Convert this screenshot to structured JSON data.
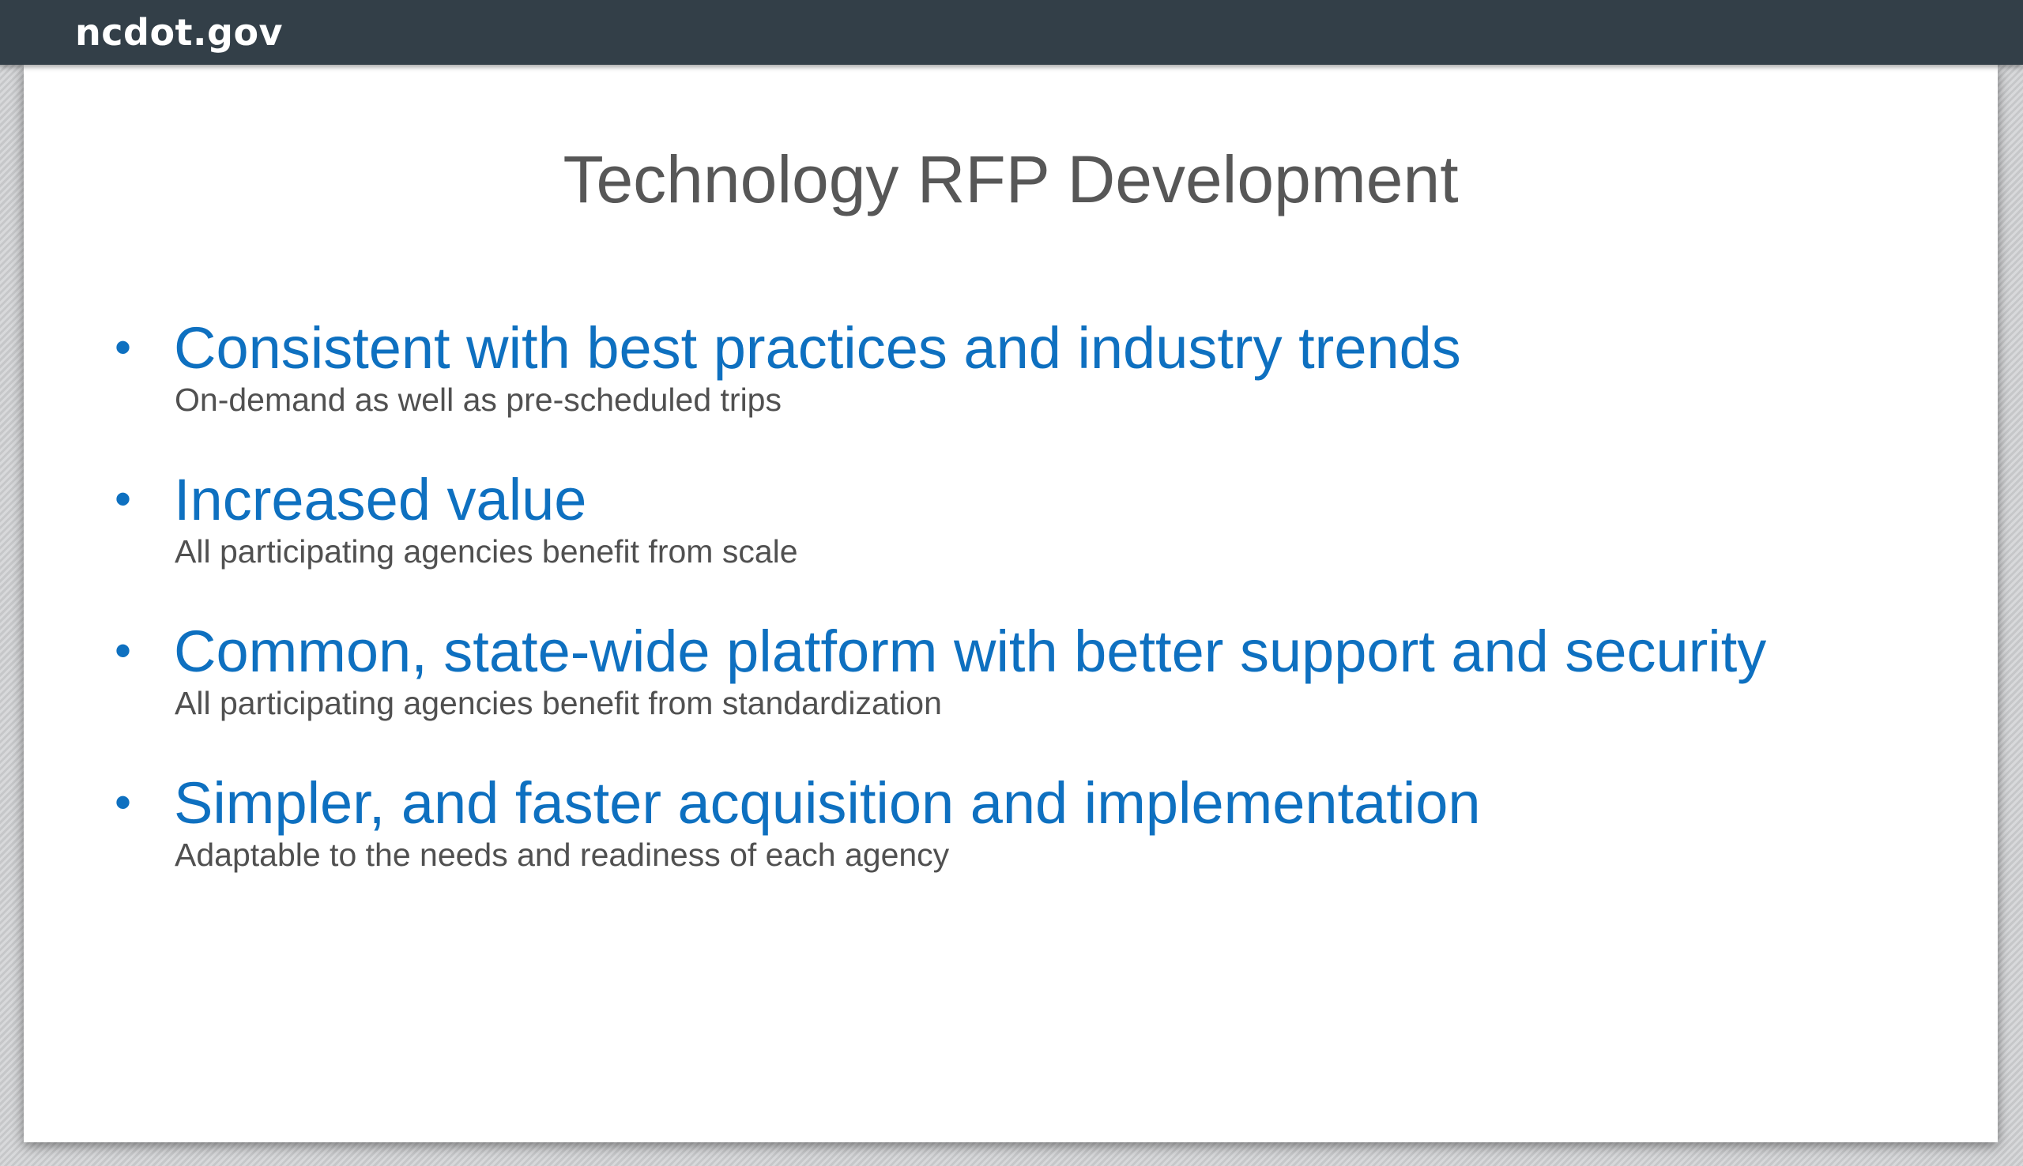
{
  "header": {
    "site_name": "ncdot.gov",
    "background_color": "#333f48"
  },
  "slide": {
    "title": "Technology RFP Development",
    "accent_color": "#0e70c0",
    "bullets": [
      {
        "heading": "Consistent with best practices and industry trends",
        "sub": "On-demand as well as pre-scheduled trips"
      },
      {
        "heading": "Increased value",
        "sub": "All participating agencies benefit from scale"
      },
      {
        "heading": "Common, state-wide platform with better support and security",
        "sub": "All participating agencies benefit from standardization"
      },
      {
        "heading": "Simpler, and faster acquisition and implementation",
        "sub": "Adaptable to the needs and readiness of each agency"
      }
    ]
  }
}
